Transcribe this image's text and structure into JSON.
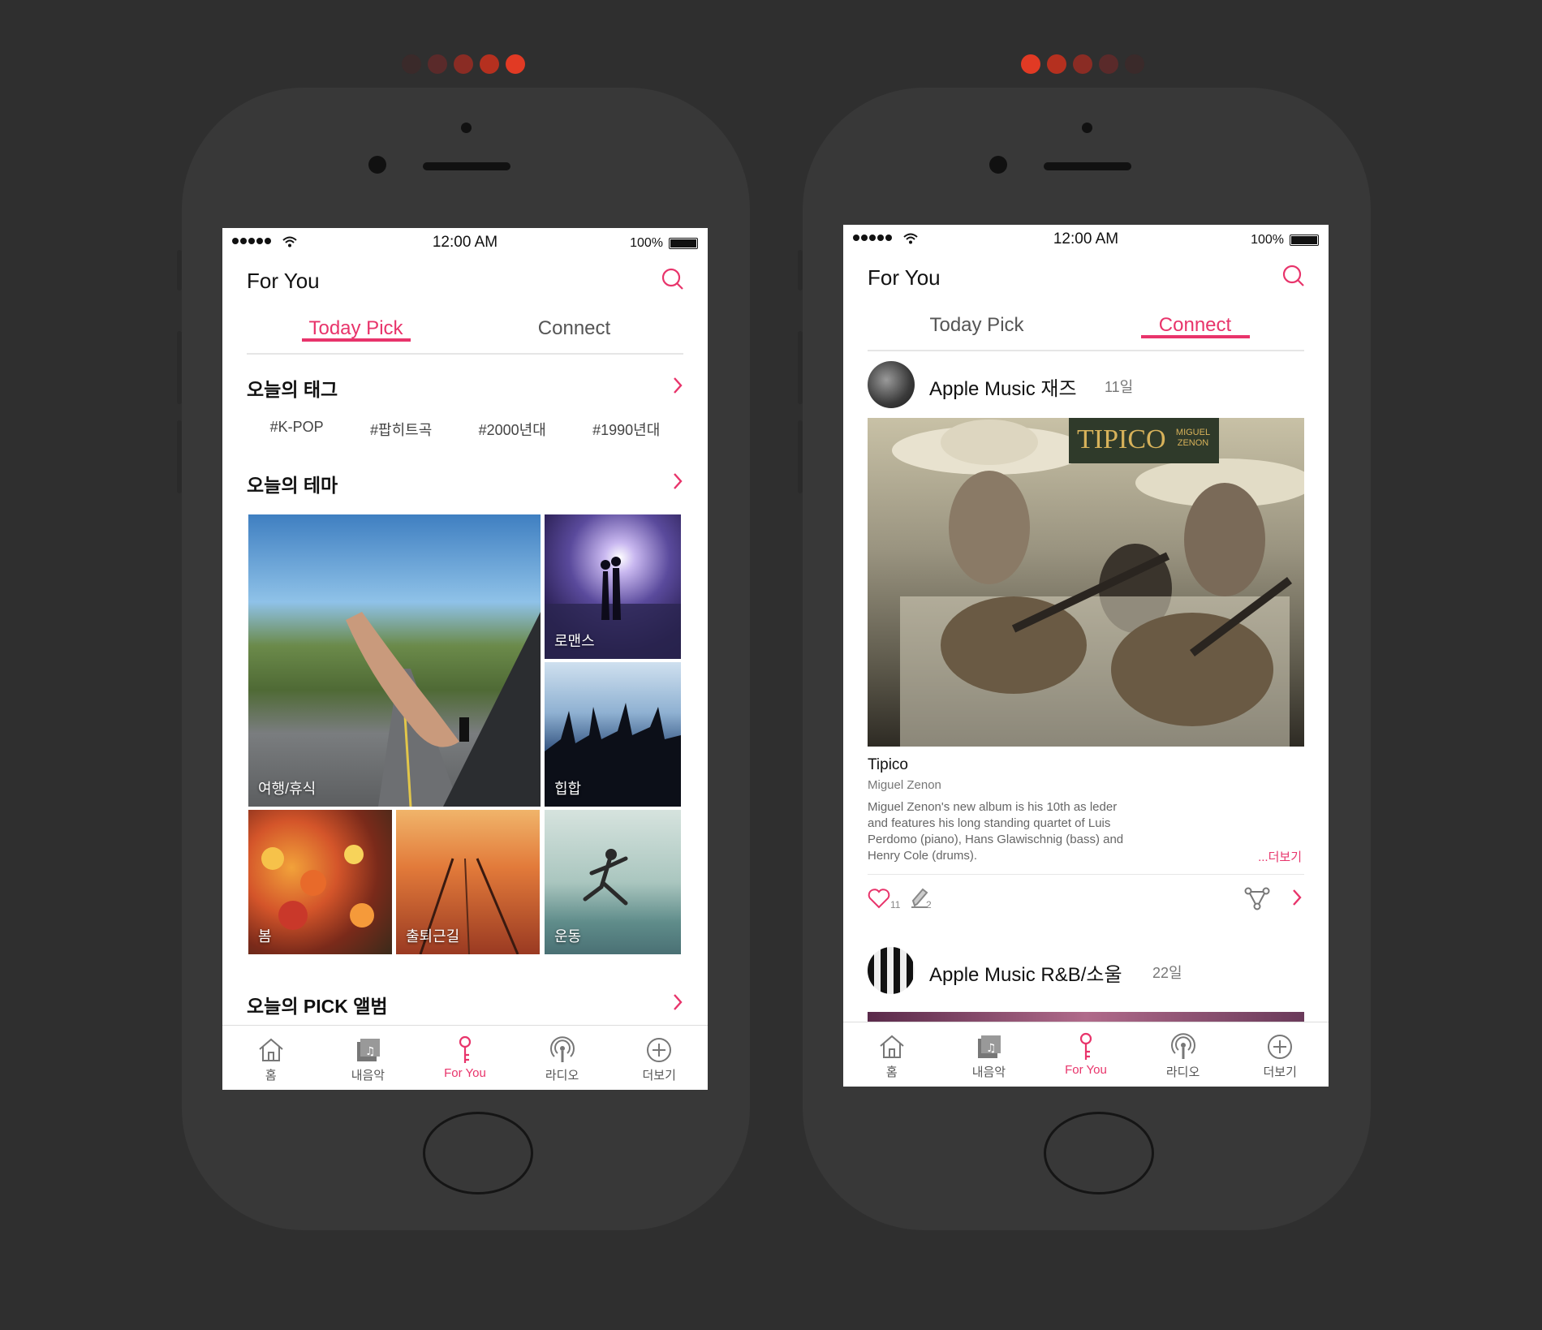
{
  "colors": {
    "accent": "#e8346b",
    "background": "#2f2f2f",
    "phone_body": "#383838"
  },
  "left_pager": {
    "dots": [
      "#3a2a2a",
      "#5a2a2a",
      "#8a2c24",
      "#b5301f",
      "#e13a24"
    ]
  },
  "right_pager": {
    "dots": [
      "#e13a24",
      "#b5301f",
      "#8a2c24",
      "#5a2a2a",
      "#3a2a2a"
    ]
  },
  "left": {
    "status": {
      "time": "12:00 AM",
      "battery": "100%"
    },
    "header": {
      "title": "For You",
      "search_icon": "search-icon"
    },
    "tabs": [
      {
        "label": "Today Pick",
        "active": true
      },
      {
        "label": "Connect",
        "active": false
      }
    ],
    "tags_section": {
      "title": "오늘의 태그",
      "tags": [
        "#K-POP",
        "#팝히트곡",
        "#2000년대",
        "#1990년대"
      ]
    },
    "theme_section": {
      "title": "오늘의 테마",
      "tiles": [
        "여행/휴식",
        "로맨스",
        "힙합",
        "봄",
        "출퇴근길",
        "운동"
      ]
    },
    "pick_section": {
      "title": "오늘의 PICK 앨범"
    },
    "tabbar": [
      {
        "label": "홈",
        "icon": "home-icon",
        "active": false
      },
      {
        "label": "내음악",
        "icon": "my-music-icon",
        "active": false
      },
      {
        "label": "For You",
        "icon": "for-you-key-icon",
        "active": true
      },
      {
        "label": "라디오",
        "icon": "radio-icon",
        "active": false
      },
      {
        "label": "더보기",
        "icon": "more-plus-icon",
        "active": false
      }
    ]
  },
  "right": {
    "status": {
      "time": "12:00 AM",
      "battery": "100%"
    },
    "header": {
      "title": "For You",
      "search_icon": "search-icon"
    },
    "tabs": [
      {
        "label": "Today Pick",
        "active": false
      },
      {
        "label": "Connect",
        "active": true
      }
    ],
    "post1": {
      "name": "Apple Music 재즈",
      "date": "11일",
      "cover_title": "TIPICO",
      "cover_subtitle": "MIGUEL ZENON",
      "album": "Tipico",
      "artist": "Miguel Zenon",
      "description": "Miguel Zenon's new album is his 10th as leder and features his long standing quartet of Luis Perdomo (piano), Hans Glawischnig (bass) and Henry Cole (drums).",
      "more": "...더보기",
      "likes": "11",
      "comments": "2"
    },
    "post2": {
      "name": "Apple Music R&B/소울",
      "date": "22일"
    },
    "tabbar": [
      {
        "label": "홈",
        "icon": "home-icon",
        "active": false
      },
      {
        "label": "내음악",
        "icon": "my-music-icon",
        "active": false
      },
      {
        "label": "For You",
        "icon": "for-you-key-icon",
        "active": true
      },
      {
        "label": "라디오",
        "icon": "radio-icon",
        "active": false
      },
      {
        "label": "더보기",
        "icon": "more-plus-icon",
        "active": false
      }
    ]
  }
}
